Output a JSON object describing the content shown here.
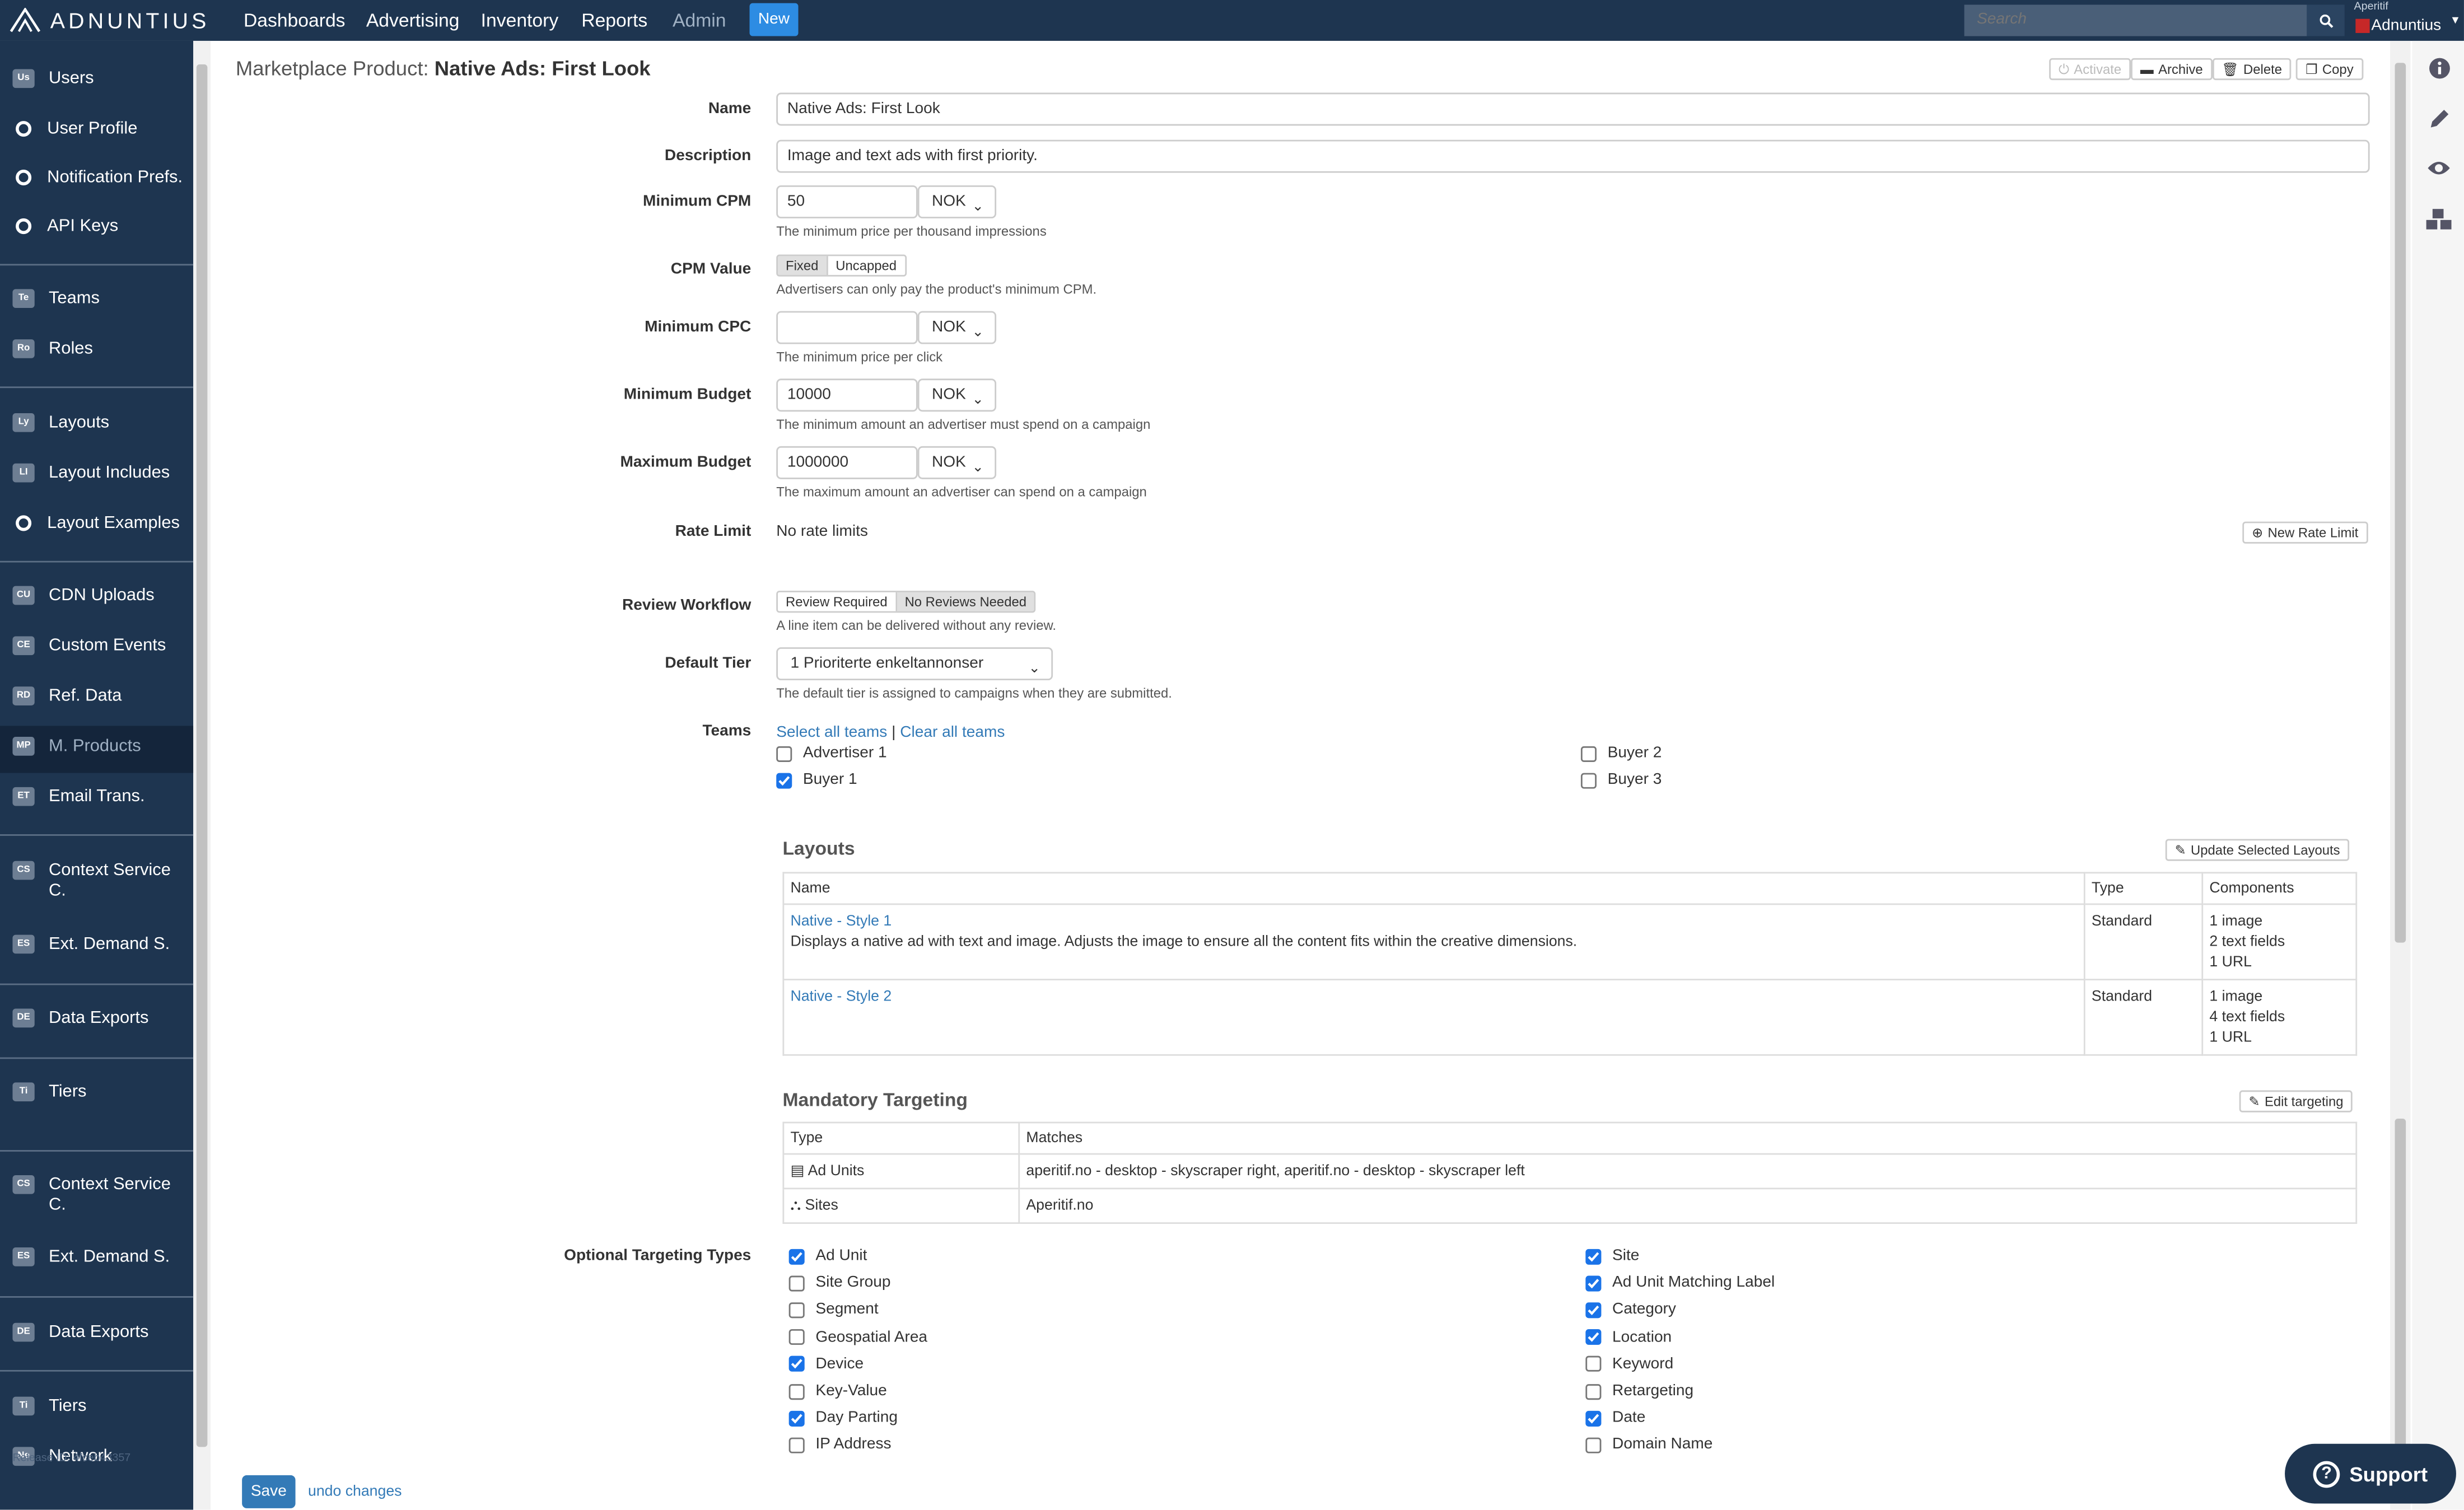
{
  "topnav": {
    "brand": "ADNUNTIUS",
    "items": [
      "Dashboards",
      "Advertising",
      "Inventory",
      "Reports",
      "Admin"
    ],
    "new_label": "New",
    "search_placeholder": "Search",
    "network": "Aperitif",
    "user": "Adnuntius"
  },
  "sidebar": {
    "items": [
      {
        "badge": "Us",
        "label": "Users"
      },
      {
        "badge": "",
        "label": "User Profile"
      },
      {
        "badge": "",
        "label": "Notification Prefs."
      },
      {
        "badge": "",
        "label": "API Keys"
      },
      {
        "badge": "Te",
        "label": "Teams"
      },
      {
        "badge": "Ro",
        "label": "Roles"
      },
      {
        "badge": "Ly",
        "label": "Layouts"
      },
      {
        "badge": "LI",
        "label": "Layout Includes"
      },
      {
        "badge": "",
        "label": "Layout Examples"
      },
      {
        "badge": "CU",
        "label": "CDN Uploads"
      },
      {
        "badge": "CE",
        "label": "Custom Events"
      },
      {
        "badge": "RD",
        "label": "Ref. Data"
      },
      {
        "badge": "MP",
        "label": "M. Products"
      },
      {
        "badge": "ET",
        "label": "Email Trans."
      },
      {
        "badge": "CS",
        "label": "Context Service C."
      },
      {
        "badge": "ES",
        "label": "Ext. Demand S."
      },
      {
        "badge": "DE",
        "label": "Data Exports"
      },
      {
        "badge": "Ti",
        "label": "Tiers"
      },
      {
        "badge": "CS",
        "label": "Context Service C."
      },
      {
        "badge": "ES",
        "label": "Ext. Demand S."
      },
      {
        "badge": "DE",
        "label": "Data Exports"
      },
      {
        "badge": "Ti",
        "label": "Tiers"
      },
      {
        "badge": "Ne",
        "label": "Network"
      }
    ],
    "release": "Release ID: 4fceb43357"
  },
  "page": {
    "title_prefix": "Marketplace Product:",
    "title_name": "Native Ads: First Look",
    "actions": {
      "activate": "Activate",
      "archive": "Archive",
      "delete": "Delete",
      "copy": "Copy"
    }
  },
  "form": {
    "name": {
      "label": "Name",
      "value": "Native Ads: First Look"
    },
    "description": {
      "label": "Description",
      "value": "Image and text ads with first priority."
    },
    "min_cpm": {
      "label": "Minimum CPM",
      "value": "50",
      "currency": "NOK",
      "help": "The minimum price per thousand impressions"
    },
    "cpm_value": {
      "label": "CPM Value",
      "options": [
        "Fixed",
        "Uncapped"
      ],
      "help": "Advertisers can only pay the product's minimum CPM."
    },
    "min_cpc": {
      "label": "Minimum CPC",
      "value": "",
      "currency": "NOK",
      "help": "The minimum price per click"
    },
    "min_budget": {
      "label": "Minimum Budget",
      "value": "10000",
      "currency": "NOK",
      "help": "The minimum amount an advertiser must spend on a campaign"
    },
    "max_budget": {
      "label": "Maximum Budget",
      "value": "1000000",
      "currency": "NOK",
      "help": "The maximum amount an advertiser can spend on a campaign"
    },
    "rate_limit": {
      "label": "Rate Limit",
      "value": "No rate limits",
      "button": "New Rate Limit"
    },
    "review": {
      "label": "Review Workflow",
      "options": [
        "Review Required",
        "No Reviews Needed"
      ],
      "help": "A line item can be delivered without any review."
    },
    "tier": {
      "label": "Default Tier",
      "value": "1 Prioriterte enkeltannonser",
      "help": "The default tier is assigned to campaigns when they are submitted."
    },
    "teams": {
      "label": "Teams",
      "select_all": "Select all teams",
      "sep": "|",
      "clear_all": "Clear all teams",
      "items": [
        {
          "label": "Advertiser 1",
          "checked": false
        },
        {
          "label": "Buyer 1",
          "checked": true
        },
        {
          "label": "Buyer 2",
          "checked": false
        },
        {
          "label": "Buyer 3",
          "checked": false
        }
      ]
    }
  },
  "layouts": {
    "heading": "Layouts",
    "button": "Update Selected Layouts",
    "columns": [
      "Name",
      "Type",
      "Components"
    ],
    "rows": [
      {
        "name": "Native - Style 1",
        "desc": "Displays a native ad with text and image. Adjusts the image to ensure all the content fits within the creative dimensions.",
        "type": "Standard",
        "c1": "1 image",
        "c2": "2 text fields",
        "c3": "1 URL"
      },
      {
        "name": "Native - Style 2",
        "desc": "",
        "type": "Standard",
        "c1": "1 image",
        "c2": "4 text fields",
        "c3": "1 URL"
      }
    ]
  },
  "targeting": {
    "heading": "Mandatory Targeting",
    "button": "Edit targeting",
    "columns": [
      "Type",
      "Matches"
    ],
    "rows": [
      {
        "type": "Ad Units",
        "matches": "aperitif.no - desktop - skyscraper right, aperitif.no - desktop - skyscraper left"
      },
      {
        "type": "Sites",
        "matches": "Aperitif.no"
      }
    ]
  },
  "optional": {
    "label": "Optional Targeting Types",
    "left": [
      {
        "label": "Ad Unit",
        "checked": true
      },
      {
        "label": "Site Group",
        "checked": false
      },
      {
        "label": "Segment",
        "checked": false
      },
      {
        "label": "Geospatial Area",
        "checked": false
      },
      {
        "label": "Device",
        "checked": true
      },
      {
        "label": "Key-Value",
        "checked": false
      },
      {
        "label": "Day Parting",
        "checked": true
      },
      {
        "label": "IP Address",
        "checked": false
      }
    ],
    "right": [
      {
        "label": "Site",
        "checked": true
      },
      {
        "label": "Ad Unit Matching Label",
        "checked": true
      },
      {
        "label": "Category",
        "checked": true
      },
      {
        "label": "Location",
        "checked": true
      },
      {
        "label": "Keyword",
        "checked": false
      },
      {
        "label": "Retargeting",
        "checked": false
      },
      {
        "label": "Date",
        "checked": true
      },
      {
        "label": "Domain Name",
        "checked": false
      }
    ]
  },
  "footer": {
    "save": "Save",
    "undo": "undo changes",
    "support": "Support"
  }
}
